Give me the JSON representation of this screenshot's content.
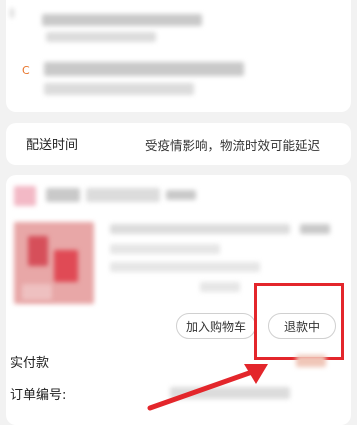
{
  "delivery": {
    "label": "配送时间",
    "note": "受疫情影响，物流时效可能延迟"
  },
  "address": {
    "icon": "C"
  },
  "order_item": {
    "add_to_cart_label": "加入购物车",
    "refund_status_label": "退款中"
  },
  "summary": {
    "paid_label": "实付款",
    "order_number_label": "订单编号:"
  },
  "colors": {
    "accent": "#e8742a",
    "highlight": "#e3262b",
    "background": "#f2f2f2"
  }
}
